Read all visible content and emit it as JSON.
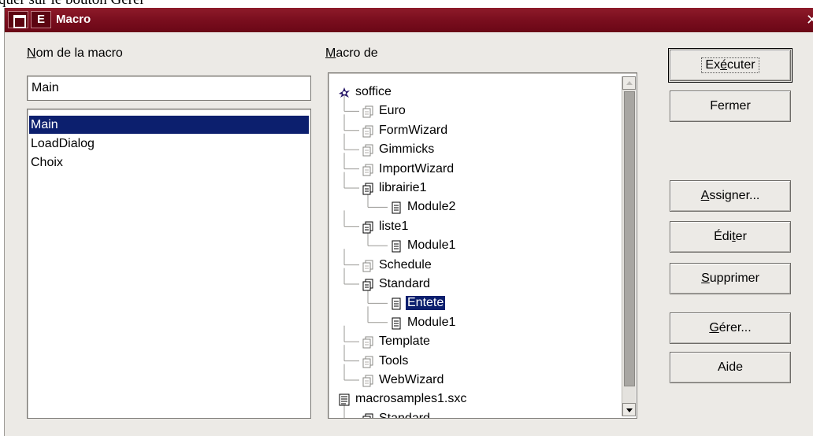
{
  "caption": "quer sur le bouton Gérer",
  "window": {
    "title": "Macro",
    "e_button": "E",
    "close_glyph": "✕"
  },
  "labels": {
    "macro_name": "Nom de la macro",
    "macro_from": "Macro de"
  },
  "macro_name_input": {
    "value": "Main"
  },
  "macro_list": [
    {
      "label": "Main",
      "selected": true
    },
    {
      "label": "LoadDialog",
      "selected": false
    },
    {
      "label": "Choix",
      "selected": false
    }
  ],
  "tree": [
    {
      "label": "soffice",
      "level": 0,
      "icon": "soffice-icon"
    },
    {
      "label": "Euro",
      "level": 1,
      "icon": "library-icon"
    },
    {
      "label": "FormWizard",
      "level": 1,
      "icon": "library-icon"
    },
    {
      "label": "Gimmicks",
      "level": 1,
      "icon": "library-icon"
    },
    {
      "label": "ImportWizard",
      "level": 1,
      "icon": "library-icon"
    },
    {
      "label": "librairie1",
      "level": 1,
      "icon": "library-open-icon"
    },
    {
      "label": "Module2",
      "level": 2,
      "icon": "module-icon"
    },
    {
      "label": "liste1",
      "level": 1,
      "icon": "library-open-icon"
    },
    {
      "label": "Module1",
      "level": 2,
      "icon": "module-icon"
    },
    {
      "label": "Schedule",
      "level": 1,
      "icon": "library-icon"
    },
    {
      "label": "Standard",
      "level": 1,
      "icon": "library-open-icon"
    },
    {
      "label": "Entete",
      "level": 2,
      "icon": "module-icon",
      "selected": true
    },
    {
      "label": "Module1",
      "level": 2,
      "icon": "module-icon"
    },
    {
      "label": "Template",
      "level": 1,
      "icon": "library-icon"
    },
    {
      "label": "Tools",
      "level": 1,
      "icon": "library-icon"
    },
    {
      "label": "WebWizard",
      "level": 1,
      "icon": "library-icon"
    },
    {
      "label": "macrosamples1.sxc",
      "level": 0,
      "icon": "document-icon"
    },
    {
      "label": "Standard",
      "level": 1,
      "icon": "library-open-icon"
    }
  ],
  "buttons": {
    "execute": "Exécuter",
    "close": "Fermer",
    "assign": "Assigner...",
    "edit": "Éditer",
    "delete": "Supprimer",
    "manage": "Gérer...",
    "help": "Aide"
  },
  "colors": {
    "titlebar": "#7a0e1e",
    "selection": "#0c1f6e",
    "dialog_bg": "#eceae6"
  }
}
